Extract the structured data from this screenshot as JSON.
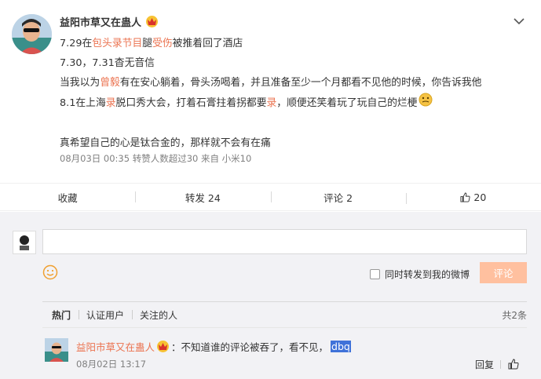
{
  "post": {
    "author": "益阳市草又在蛊人",
    "lines": {
      "l1_a": "7.29在",
      "l1_link1": "包头录节目",
      "l1_b": "腿",
      "l1_link2": "受伤",
      "l1_c": "被推着回了酒店",
      "l2": "7.30，7.31杳无音信",
      "l3_a": "当我以为",
      "l3_link": "曾毅",
      "l3_b": "有在安心躺着，骨头汤喝着，并且准备至少一个月都看不见他的时候，你告诉我他",
      "l4_a": "8.1在上海",
      "l4_link1": "录",
      "l4_b": "脱口秀大会，打着石膏拄着拐都要",
      "l4_link2": "录",
      "l4_c": "，顺便还笑着玩了玩自己的烂梗",
      "l5": "真希望自己的心是钛合金的，那样就不会有在痛"
    },
    "meta": "08月03日 00:35 转赞人数超过30  来自 小米10"
  },
  "actions": {
    "favorite": "收藏",
    "repost": "转发 24",
    "comment": "评论 2",
    "like": "20"
  },
  "composer": {
    "input_value": "",
    "repost_option": "同时转发到我的微博",
    "submit": "评论"
  },
  "comment_tabs": {
    "hot": "热门",
    "verified": "认证用户",
    "following": "关注的人",
    "total": "共2条"
  },
  "comment": {
    "author": "益阳市草又在蛊人",
    "text": "：不知道谁的评论被吞了，看不见，",
    "highlighted": "dbq",
    "time": "08月02日 13:17",
    "reply": "回复"
  },
  "colors": {
    "link": "#eb7350",
    "submit_bg": "#ffc09f",
    "selection": "#3f72d9"
  }
}
